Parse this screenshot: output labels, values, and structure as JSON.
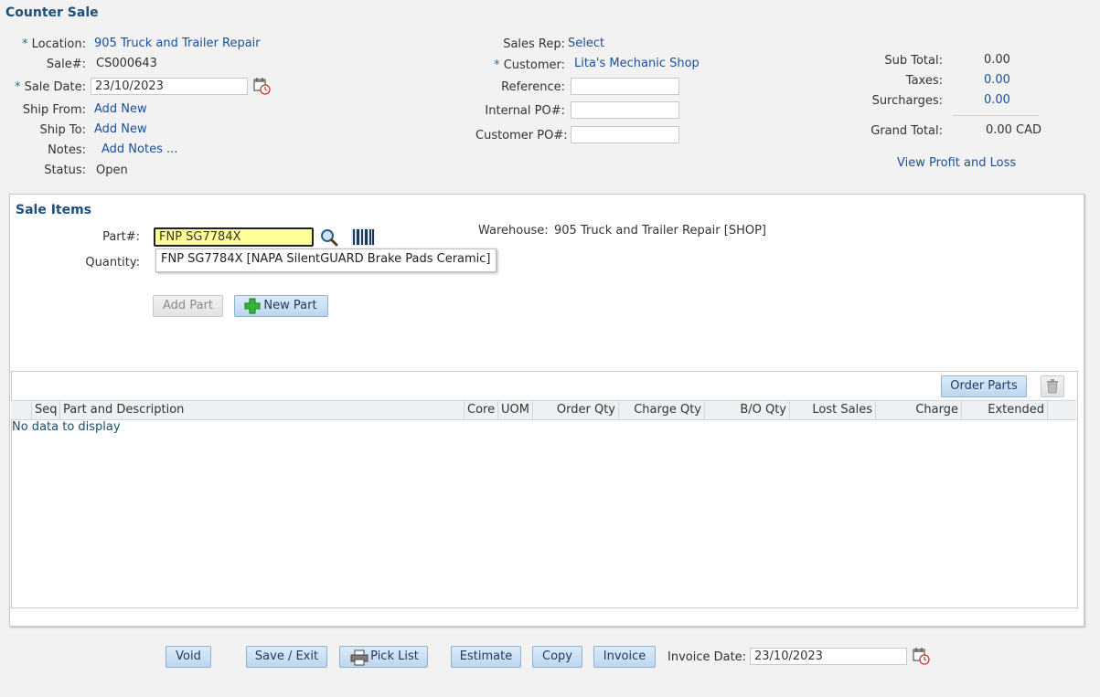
{
  "page": {
    "title": "Counter Sale"
  },
  "header": {
    "location": {
      "label": "Location:",
      "value": "905 Truck and Trailer Repair"
    },
    "sale_no": {
      "label": "Sale#:",
      "value": "CS000643"
    },
    "sale_date": {
      "label": "Sale Date:",
      "value": "23/10/2023"
    },
    "ship_from": {
      "label": "Ship From:",
      "link": "Add New"
    },
    "ship_to": {
      "label": "Ship To:",
      "link": "Add New"
    },
    "notes": {
      "label": "Notes:",
      "link": "Add Notes ..."
    },
    "status": {
      "label": "Status:",
      "value": "Open"
    },
    "required_mark": "*"
  },
  "middle": {
    "sales_rep": {
      "label": "Sales Rep:",
      "link": "Select"
    },
    "customer": {
      "label": "Customer:",
      "link": "Lita's Mechanic Shop"
    },
    "reference": {
      "label": "Reference:",
      "value": ""
    },
    "internal_po": {
      "label": "Internal PO#:",
      "value": ""
    },
    "customer_po": {
      "label": "Customer PO#:",
      "value": ""
    }
  },
  "totals": {
    "sub_total": {
      "label": "Sub Total:",
      "value": "0.00"
    },
    "taxes": {
      "label": "Taxes:",
      "value": "0.00"
    },
    "surcharges": {
      "label": "Surcharges:",
      "value": "0.00"
    },
    "grand_total": {
      "label": "Grand Total:",
      "value": "0.00",
      "currency": "CAD"
    },
    "profit_link": "View Profit and Loss"
  },
  "sale_items": {
    "title": "Sale Items",
    "part_label": "Part#:",
    "part_value": "FNP SG7784X",
    "quantity_label": "Quantity:",
    "suggestion": "FNP SG7784X [NAPA SilentGUARD Brake Pads Ceramic]",
    "warehouse_label": "Warehouse:",
    "warehouse_value": "905 Truck and Trailer Repair [SHOP]",
    "add_part": "Add Part",
    "new_part": "New Part",
    "order_parts": "Order Parts",
    "columns": [
      "Seq",
      "Part and Description",
      "Core",
      "UOM",
      "Order Qty",
      "Charge Qty",
      "B/O Qty",
      "Lost Sales",
      "Charge",
      "Extended"
    ],
    "empty_text": "No data to display"
  },
  "footer": {
    "void": "Void",
    "save_exit": "Save / Exit",
    "pick_list": "Pick List",
    "estimate": "Estimate",
    "copy": "Copy",
    "invoice": "Invoice",
    "invoice_date_label": "Invoice Date:",
    "invoice_date_value": "23/10/2023"
  },
  "colors": {
    "link": "#1a4f9c",
    "title": "#1f4e79",
    "button": "#bcd6ee",
    "part_highlight": "#ffff99"
  },
  "icons": [
    "calendar-clock-icon",
    "search-icon",
    "barcode-icon",
    "plus-icon",
    "trash-icon",
    "printer-icon"
  ]
}
